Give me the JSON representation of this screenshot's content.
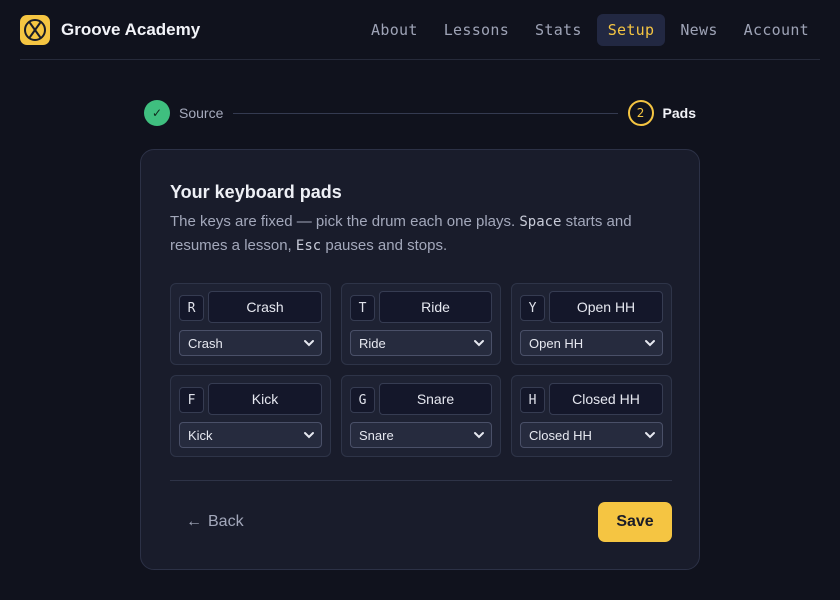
{
  "app": {
    "name": "Groove Academy",
    "logo_icon": "drumsticks-cross-icon",
    "accent": "#f5c542"
  },
  "nav": {
    "items": [
      {
        "label": "About",
        "active": false
      },
      {
        "label": "Lessons",
        "active": false
      },
      {
        "label": "Stats",
        "active": false
      },
      {
        "label": "Setup",
        "active": true
      },
      {
        "label": "News",
        "active": false
      },
      {
        "label": "Account",
        "active": false
      }
    ]
  },
  "stepper": {
    "steps": [
      {
        "label": "Source",
        "status": "done",
        "marker": "✓"
      },
      {
        "label": "Pads",
        "status": "active",
        "marker": "2"
      }
    ]
  },
  "card": {
    "title": "Your keyboard pads",
    "desc_part1": "The keys are fixed — pick the drum each one plays. ",
    "desc_key1": "Space",
    "desc_part2": " starts and resumes a lesson, ",
    "desc_key2": "Esc",
    "desc_part3": " pauses and stops."
  },
  "pads": [
    {
      "key": "R",
      "name": "Crash",
      "selected": "Crash"
    },
    {
      "key": "T",
      "name": "Ride",
      "selected": "Ride"
    },
    {
      "key": "Y",
      "name": "Open HH",
      "selected": "Open HH"
    },
    {
      "key": "F",
      "name": "Kick",
      "selected": "Kick"
    },
    {
      "key": "G",
      "name": "Snare",
      "selected": "Snare"
    },
    {
      "key": "H",
      "name": "Closed HH",
      "selected": "Closed HH"
    }
  ],
  "actions": {
    "back_label": "Back",
    "back_arrow": "←",
    "save_label": "Save"
  }
}
